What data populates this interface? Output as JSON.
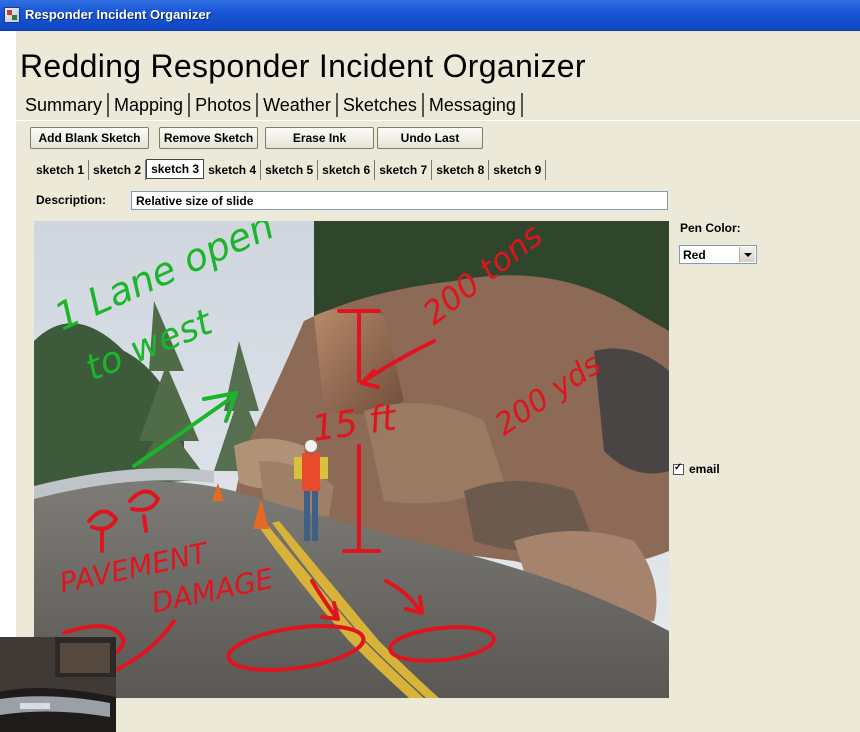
{
  "window": {
    "title": "Responder Incident Organizer"
  },
  "app": {
    "heading": "Redding Responder Incident Organizer"
  },
  "main_tabs": [
    "Summary",
    "Mapping",
    "Photos",
    "Weather",
    "Sketches",
    "Messaging"
  ],
  "active_main_tab": "Sketches",
  "toolbar": {
    "add_blank": "Add Blank Sketch",
    "remove": "Remove Sketch",
    "erase": "Erase Ink",
    "undo": "Undo Last"
  },
  "sketch_tabs": [
    "sketch 1",
    "sketch 2",
    "sketch 3",
    "sketch 4",
    "sketch 5",
    "sketch 6",
    "sketch 7",
    "sketch 8",
    "sketch 9"
  ],
  "active_sketch_tab": "sketch 3",
  "description": {
    "label": "Description:",
    "value": "Relative size of slide"
  },
  "pen": {
    "label": "Pen Color:",
    "selected": "Red"
  },
  "email": {
    "label": "email",
    "checked": true
  },
  "annotations": {
    "green_1": "1 Lane open",
    "green_2": "to west",
    "tons": "200 tons",
    "height": "15 ft",
    "yards": "200 yds",
    "pavement": "PAVEMENT",
    "damage": "DAMAGE"
  },
  "colors": {
    "titlebar": "#1a56d6",
    "ink_red": "#e0141e",
    "ink_green": "#1bb52a"
  }
}
